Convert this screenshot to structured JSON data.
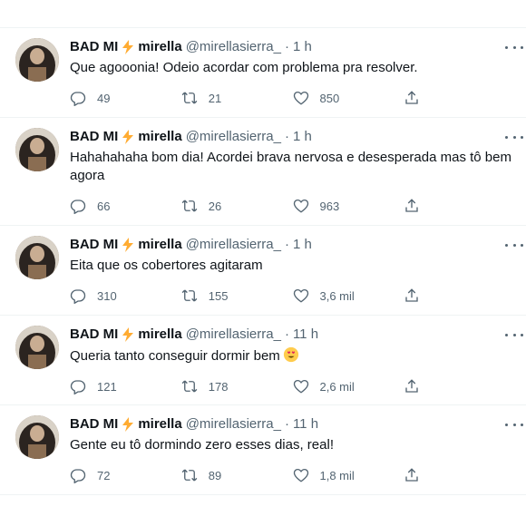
{
  "tweets": [
    {
      "display_name": "BAD MI",
      "name_part": "mirella",
      "handle": "@mirellasierra_",
      "time": "1 h",
      "text": "Que agooonia! Odeio acordar com problema pra resolver.",
      "replies": "49",
      "retweets": "21",
      "likes": "850"
    },
    {
      "display_name": "BAD MI",
      "name_part": "mirella",
      "handle": "@mirellasierra_",
      "time": "1 h",
      "text": "Hahahahaha bom dia! Acordei brava nervosa e desesperada mas tô bem\nagora",
      "replies": "66",
      "retweets": "26",
      "likes": "963"
    },
    {
      "display_name": "BAD MI",
      "name_part": "mirella",
      "handle": "@mirellasierra_",
      "time": "1 h",
      "text": "Eita que os cobertores agitaram",
      "replies": "310",
      "retweets": "155",
      "likes": "3,6 mil"
    },
    {
      "display_name": "BAD MI",
      "name_part": "mirella",
      "handle": "@mirellasierra_",
      "time": "11 h",
      "text": "Queria tanto conseguir dormir bem",
      "replies": "121",
      "retweets": "178",
      "likes": "2,6 mil"
    },
    {
      "display_name": "BAD MI",
      "name_part": "mirella",
      "handle": "@mirellasierra_",
      "time": "11 h",
      "text": "Gente eu tô dormindo zero esses dias, real!",
      "replies": "72",
      "retweets": "89",
      "likes": "1,8 mil"
    }
  ],
  "separator": "·",
  "icons": {
    "reply": "reply-icon",
    "retweet": "retweet-icon",
    "like": "like-icon",
    "share": "share-icon",
    "more": "more-icon",
    "bolt": "lightning-emoji",
    "emoji_tweet_4": "smiling-face-with-heart-eyes-emoji"
  },
  "colors": {
    "text": "#0f1419",
    "secondary": "#536471",
    "divider": "#eff3f4",
    "bolt": "#ffac33"
  }
}
